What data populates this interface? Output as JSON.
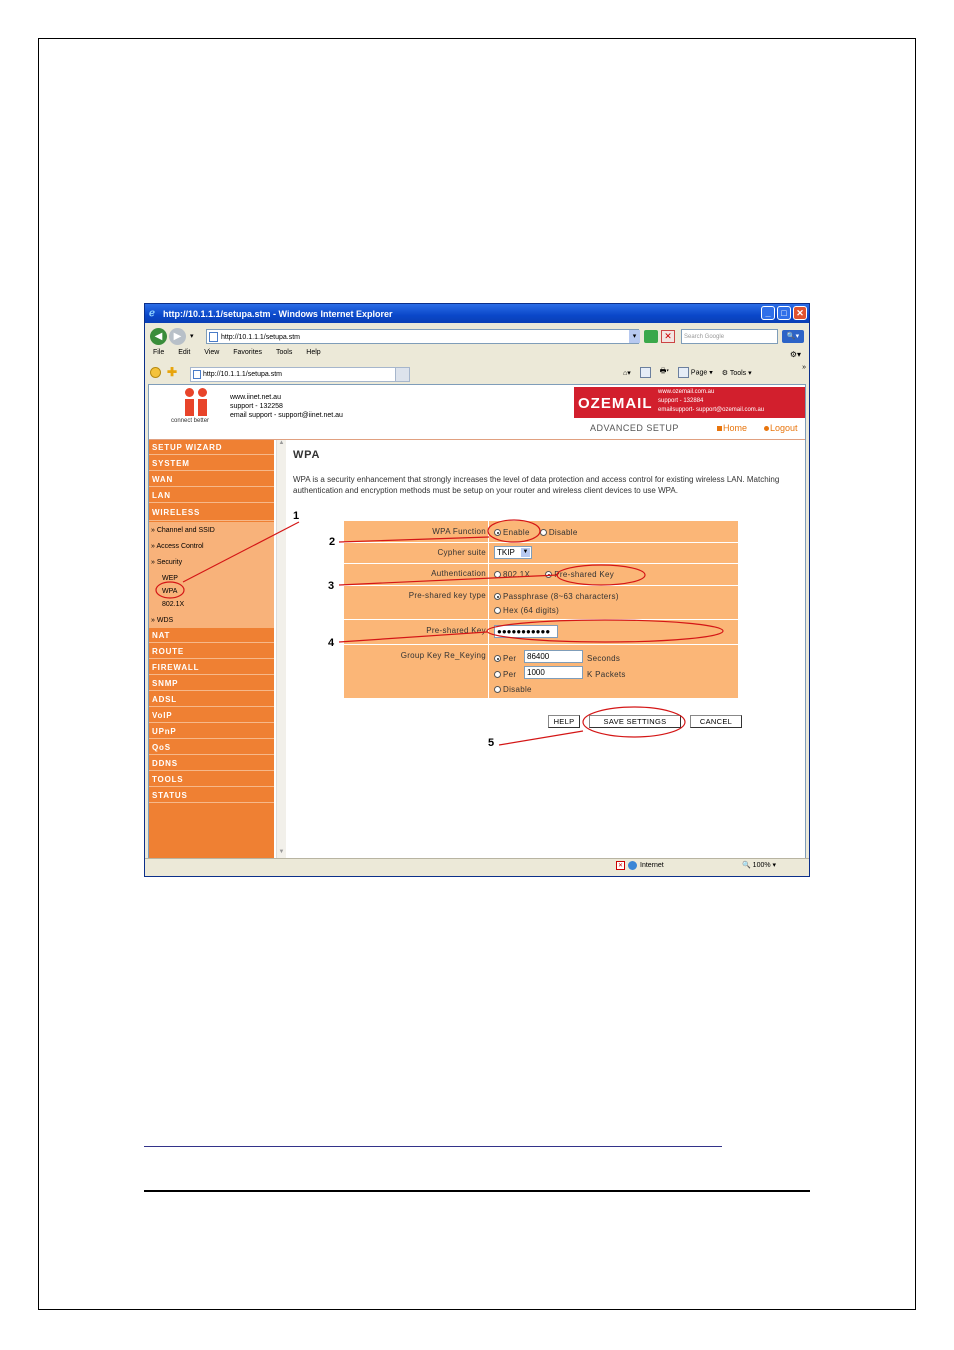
{
  "browser": {
    "title": "http://10.1.1.1/setupa.stm - Windows Internet Explorer",
    "address": "http://10.1.1.1/setupa.stm",
    "search_placeholder": "Search Google",
    "menu": [
      "File",
      "Edit",
      "View",
      "Favorites",
      "Tools",
      "Help"
    ],
    "tab_label": "http://10.1.1.1/setupa.stm",
    "cmd_page": "Page",
    "cmd_tools": "Tools",
    "status_zone": "Internet",
    "status_zoom": "100%"
  },
  "header": {
    "tagline": "connect better",
    "contact": [
      "www.iinet.net.au",
      "support - 132258",
      "email support - support@iinet.net.au"
    ],
    "oz_brand": "OZEMAIL",
    "oz_info": [
      "www.ozemail.com.au",
      "support - 132884",
      "emailsupport- support@ozemail.com.au"
    ],
    "advanced_setup": "ADVANCED SETUP",
    "home": "Home",
    "logout": "Logout"
  },
  "sidebar": {
    "items": [
      "SETUP WIZARD",
      "SYSTEM",
      "WAN",
      "LAN",
      "WIRELESS",
      "NAT",
      "ROUTE",
      "FIREWALL",
      "SNMP",
      "ADSL",
      "VoIP",
      "UPnP",
      "QoS",
      "DDNS",
      "TOOLS",
      "STATUS"
    ],
    "wireless_sub": [
      "» Channel and SSID",
      "» Access Control",
      "» Security",
      "WEP",
      "WPA",
      "802.1X",
      "» WDS"
    ]
  },
  "main": {
    "title": "WPA",
    "description": "WPA is a security enhancement that strongly increases the level of data protection and access control for existing wireless LAN. Matching authentication and encryption methods must be setup on your router and wireless client devices to use WPA.",
    "wpa_function_label": "WPA Function",
    "wpa_function_options": [
      "Enable",
      "Disable"
    ],
    "cypher_label": "Cypher suite",
    "cypher_value": "TKIP",
    "auth_label": "Authentication",
    "auth_options": [
      "802.1X",
      "Pre-shared Key"
    ],
    "psk_type_label": "Pre-shared key type",
    "psk_type_options": [
      "Passphrase (8~63 characters)",
      "Hex (64 digits)"
    ],
    "psk_label": "Pre-shared Key",
    "psk_value": "●●●●●●●●●●●",
    "rekey_label": "Group Key Re_Keying",
    "rekey_per": "Per",
    "rekey_seconds_value": "86400",
    "rekey_seconds_unit": "Seconds",
    "rekey_packets_value": "1000",
    "rekey_packets_unit": "K Packets",
    "rekey_disable": "Disable",
    "help_button": "HELP",
    "save_button": "SAVE SETTINGS",
    "cancel_button": "CANCEL"
  },
  "annotations": [
    "1",
    "2",
    "3",
    "4",
    "5"
  ]
}
